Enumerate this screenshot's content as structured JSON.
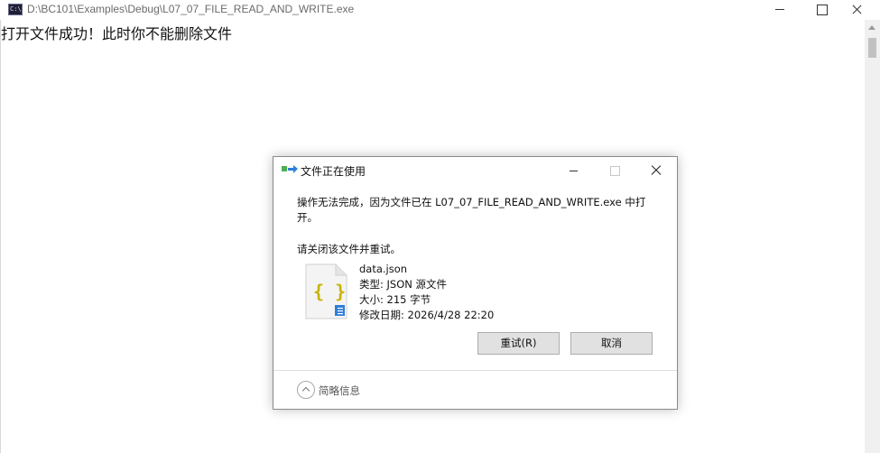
{
  "console": {
    "title": "D:\\BC101\\Examples\\Debug\\L07_07_FILE_READ_AND_WRITE.exe",
    "output": "打开文件成功！此时你不能删除文件"
  },
  "dialog": {
    "title": "文件正在使用",
    "message": "操作无法完成，因为文件已在 L07_07_FILE_READ_AND_WRITE.exe 中打开。",
    "prompt": "请关闭该文件并重试。",
    "file": {
      "name": "data.json",
      "type": "类型: JSON 源文件",
      "size": "大小: 215 字节",
      "modified": "修改日期: 2026/4/28 22:20",
      "icon_glyph": "{ }"
    },
    "buttons": {
      "retry": "重试(R)",
      "cancel": "取消"
    },
    "details_label": "简略信息"
  },
  "colors": {
    "json_brace": "#c8b400",
    "file_badge": "#2f7fd8"
  }
}
